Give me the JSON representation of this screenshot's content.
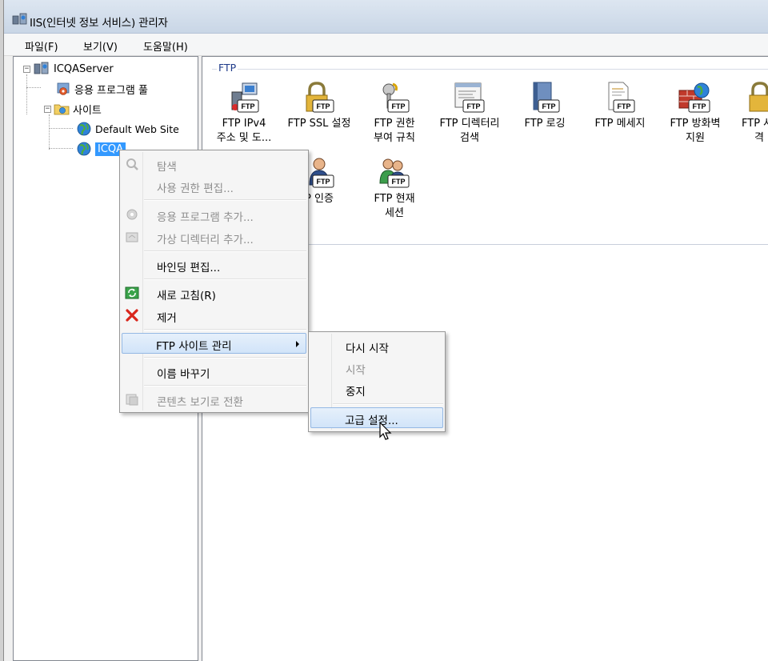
{
  "window": {
    "title": "IIS(인터넷 정보 서비스) 관리자"
  },
  "menubar": {
    "file": "파일(F)",
    "view": "보기(V)",
    "help": "도움말(H)"
  },
  "tree": {
    "server": "ICQAServer",
    "app_pools": "응용 프로그램 풀",
    "sites": "사이트",
    "default_site": "Default Web Site",
    "selected_site": "ICQA"
  },
  "features": {
    "group_title": "FTP",
    "items": [
      {
        "icon": "ftp-ipv4-icon",
        "label1": "FTP IPv4",
        "label2": "주소 및 도..."
      },
      {
        "icon": "ftp-ssl-icon",
        "label1": "FTP SSL 설정",
        "label2": ""
      },
      {
        "icon": "ftp-authorization-icon",
        "label1": "FTP 권한",
        "label2": "부여 규칙"
      },
      {
        "icon": "ftp-directory-browsing-icon",
        "label1": "FTP 디렉터리",
        "label2": "검색"
      },
      {
        "icon": "ftp-logging-icon",
        "label1": "FTP 로깅",
        "label2": ""
      },
      {
        "icon": "ftp-messages-icon",
        "label1": "FTP 메세지",
        "label2": ""
      },
      {
        "icon": "ftp-firewall-icon",
        "label1": "FTP 방화벽",
        "label2": "지원"
      },
      {
        "icon": "ftp-user-isolation-icon",
        "label1": "FTP 사",
        "label2": "격"
      },
      {
        "icon": "ftp-authentication-icon",
        "label1": "P 인증",
        "label2": ""
      },
      {
        "icon": "ftp-current-sessions-icon",
        "label1": "FTP 현재",
        "label2": "세션"
      }
    ]
  },
  "context_menu": {
    "explore": "탐색",
    "edit_permissions": "사용 권한 편집...",
    "add_application": "응용 프로그램 추가...",
    "add_virtual_directory": "가상 디렉터리 추가...",
    "edit_bindings": "바인딩 편집...",
    "refresh": "새로 고침(R)",
    "remove": "제거",
    "manage_ftp_site": "FTP 사이트 관리",
    "rename": "이름 바꾸기",
    "switch_content_view": "콘텐츠 보기로 전환"
  },
  "submenu": {
    "restart": "다시 시작",
    "start": "시작",
    "stop": "중지",
    "advanced_settings": "고급 설정..."
  }
}
